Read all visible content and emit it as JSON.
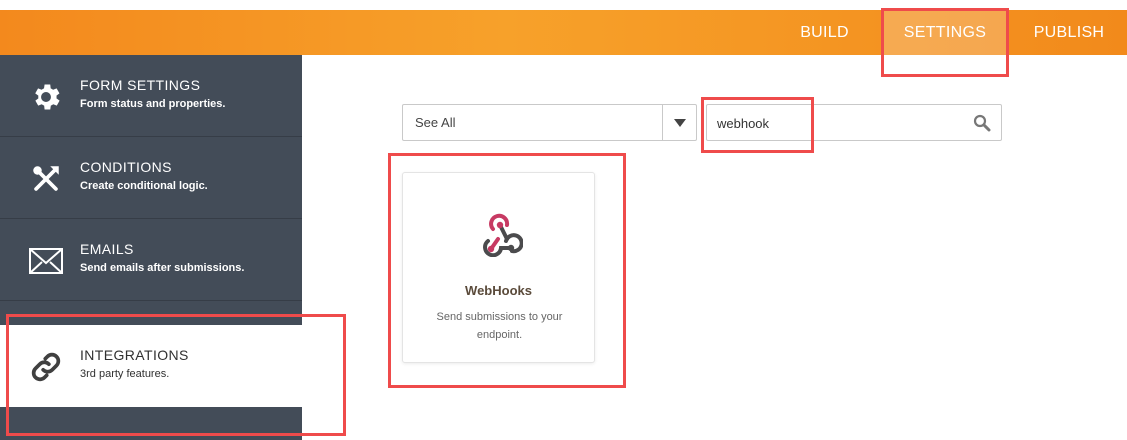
{
  "topnav": {
    "build": "BUILD",
    "settings": "SETTINGS",
    "publish": "PUBLISH"
  },
  "sidebar": {
    "items": [
      {
        "title": "FORM SETTINGS",
        "subtitle": "Form status and properties.",
        "icon": "gear-icon"
      },
      {
        "title": "CONDITIONS",
        "subtitle": "Create conditional logic.",
        "icon": "conditions-icon"
      },
      {
        "title": "EMAILS",
        "subtitle": "Send emails after submissions.",
        "icon": "envelope-icon"
      },
      {
        "title": "INTEGRATIONS",
        "subtitle": "3rd party features.",
        "icon": "link-icon"
      }
    ],
    "active_index": 3
  },
  "filter": {
    "selected": "See All"
  },
  "search": {
    "value": "webhook"
  },
  "results": [
    {
      "name": "WebHooks",
      "description": "Send submissions to your endpoint.",
      "icon": "webhook-icon"
    }
  ],
  "colors": {
    "accent": "#f3891d",
    "sidebar": "#434c58",
    "highlight": "#ef4b4b",
    "webhook_red": "#c73a63",
    "webhook_dark": "#4b4b4d"
  }
}
